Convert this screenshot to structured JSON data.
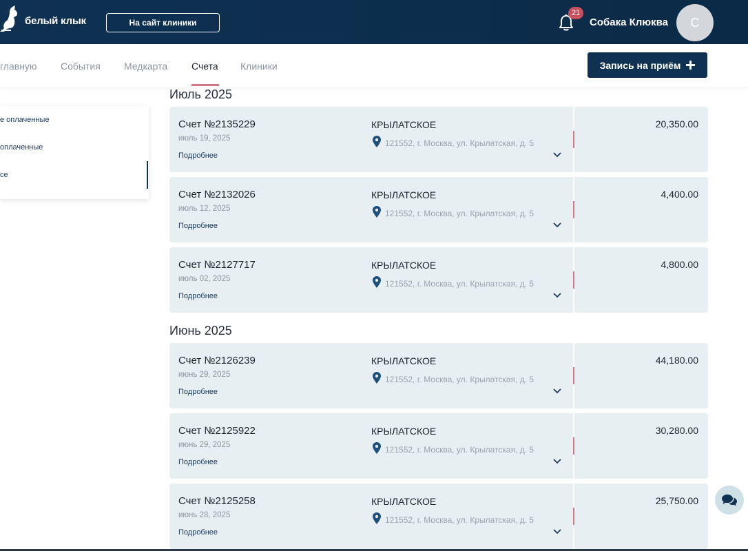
{
  "header": {
    "logo_text": "белый клык",
    "site_button": "На сайт клиники",
    "notifications_count": "21",
    "user_name": "Собака Клюква",
    "avatar_letter": "С"
  },
  "nav": {
    "items": [
      {
        "label": "главную",
        "active": false
      },
      {
        "label": "События",
        "active": false
      },
      {
        "label": "Медкарта",
        "active": false
      },
      {
        "label": "Счета",
        "active": true
      },
      {
        "label": "Клиники",
        "active": false
      }
    ],
    "book_button": "Запись на приём"
  },
  "filter": {
    "items": [
      {
        "label": "е оплаченные"
      },
      {
        "label": "оплаченные"
      },
      {
        "label": "се",
        "active": true
      }
    ]
  },
  "groups": [
    {
      "month": "Июль 2025",
      "invoices": [
        {
          "title": "Счет №2135229",
          "date": "июль 19, 2025",
          "more": "Подробнее",
          "clinic": "КРЫЛАТСКОЕ",
          "address": "121552, г. Москва, ул. Крылатская, д. 5",
          "amount": "20,350.00"
        },
        {
          "title": "Счет №2132026",
          "date": "июль 12, 2025",
          "more": "Подробнее",
          "clinic": "КРЫЛАТСКОЕ",
          "address": "121552, г. Москва, ул. Крылатская, д. 5",
          "amount": "4,400.00"
        },
        {
          "title": "Счет №2127717",
          "date": "июль 02, 2025",
          "more": "Подробнее",
          "clinic": "КРЫЛАТСКОЕ",
          "address": "121552, г. Москва, ул. Крылатская, д. 5",
          "amount": "4,800.00"
        }
      ]
    },
    {
      "month": "Июнь 2025",
      "invoices": [
        {
          "title": "Счет №2126239",
          "date": "июнь 29, 2025",
          "more": "Подробнее",
          "clinic": "КРЫЛАТСКОЕ",
          "address": "121552, г. Москва, ул. Крылатская, д. 5",
          "amount": "44,180.00"
        },
        {
          "title": "Счет №2125922",
          "date": "июнь 29, 2025",
          "more": "Подробнее",
          "clinic": "КРЫЛАТСКОЕ",
          "address": "121552, г. Москва, ул. Крылатская, д. 5",
          "amount": "30,280.00"
        },
        {
          "title": "Счет №2125258",
          "date": "июнь 28, 2025",
          "more": "Подробнее",
          "clinic": "КРЫЛАТСКОЕ",
          "address": "121552, г. Москва, ул. Крылатская, д. 5",
          "amount": "25,750.00"
        }
      ]
    }
  ],
  "icons": [
    "kangaroo-logo-icon",
    "bell-icon",
    "plus-icon",
    "location-pin-icon",
    "chevron-down-icon",
    "chat-icon"
  ],
  "colors": {
    "header_bg": "#0f3152",
    "accent": "#d27787",
    "card_bg": "#e8eff2",
    "badge": "#c8505e"
  }
}
